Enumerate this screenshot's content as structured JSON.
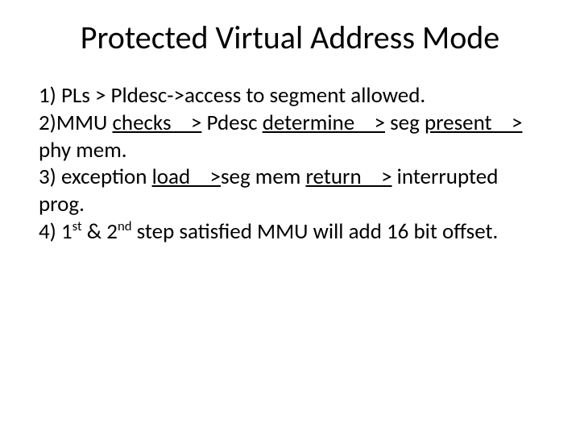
{
  "title": "Protected Virtual Address Mode",
  "body": {
    "l1": "1) PLs > Pldesc->access to segment allowed.",
    "l2a": "2)MMU ",
    "l2_checks": "checks    >",
    "l2b": " Pdesc ",
    "l2_determine": "determine    >",
    "l2c": " seg ",
    "l2_present": "present    >",
    "l2d": " phy mem.",
    "l3a": "3) exception ",
    "l3_load": "load    >",
    "l3b": "seg mem ",
    "l3_return": "return    >",
    "l3c": " interrupted prog.",
    "l4a": "4) 1",
    "l4_st": "st",
    "l4b": " & 2",
    "l4_nd": "nd",
    "l4c": " step satisfied MMU will add 16 bit offset."
  }
}
